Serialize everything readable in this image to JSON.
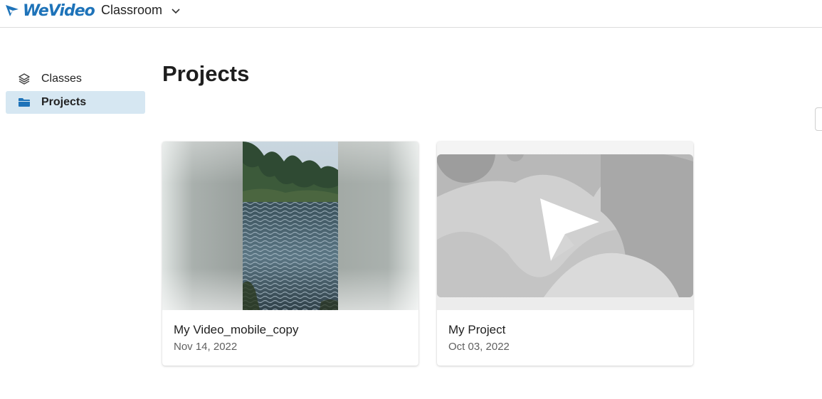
{
  "header": {
    "logo_text": "WeVideo",
    "workspace": "Classroom"
  },
  "sidebar": {
    "items": [
      {
        "label": "Classes",
        "icon": "layers-icon",
        "active": false
      },
      {
        "label": "Projects",
        "icon": "folder-icon",
        "active": true
      }
    ]
  },
  "main": {
    "title": "Projects",
    "projects": [
      {
        "title": "My Video_mobile_copy",
        "date": "Nov 14, 2022",
        "thumbnail": "lake-photo"
      },
      {
        "title": "My Project",
        "date": "Oct 03, 2022",
        "thumbnail": "wevideo-placeholder"
      }
    ]
  },
  "colors": {
    "brand": "#1e73b9",
    "active_bg": "#d6e7f2",
    "folder_icon": "#1e73b9"
  }
}
